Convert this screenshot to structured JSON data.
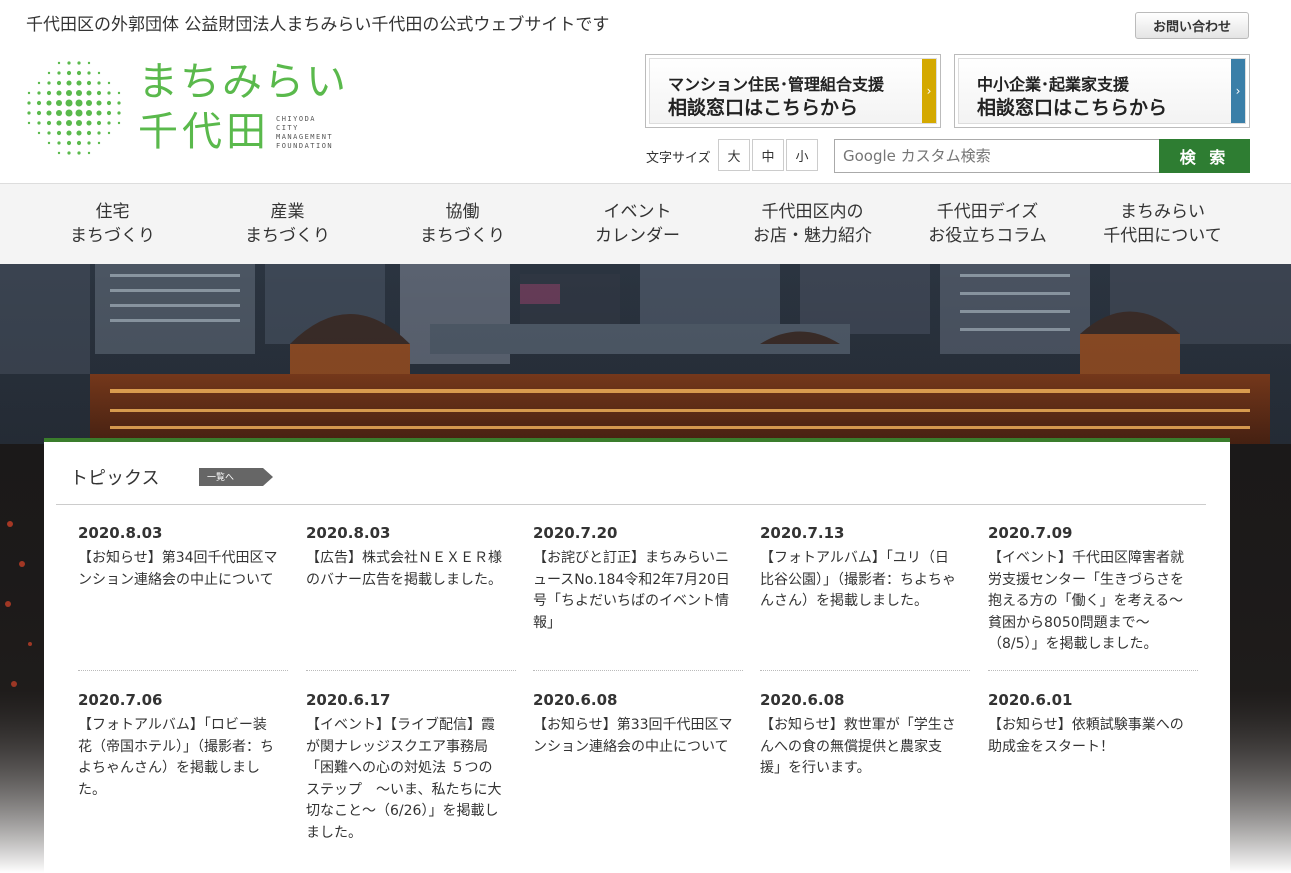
{
  "header": {
    "tagline": "千代田区の外郭団体 公益財団法人まちみらい千代田の公式ウェブサイトです",
    "contact_label": "お問い合わせ",
    "logo": {
      "main": "まちみらい",
      "sub": "千代田",
      "en": [
        "CHIYODA",
        "CITY",
        "MANAGEMENT",
        "FOUNDATION"
      ]
    },
    "banners": [
      {
        "line1": "マンション住民･管理組合支援",
        "line2": "相談窓口はこちらから",
        "arrow": "›",
        "color": "#d4a900"
      },
      {
        "line1": "中小企業･起業家支援",
        "line2": "相談窓口はこちらから",
        "arrow": "›",
        "color": "#3a7fa8"
      }
    ],
    "font_size": {
      "label": "文字サイズ",
      "large": "大",
      "medium": "中",
      "small": "小"
    },
    "search": {
      "placeholder": "Google カスタム検索",
      "button": "検 索"
    }
  },
  "nav": [
    {
      "line1": "住宅",
      "line2": "まちづくり"
    },
    {
      "line1": "産業",
      "line2": "まちづくり"
    },
    {
      "line1": "協働",
      "line2": "まちづくり"
    },
    {
      "line1": "イベント",
      "line2": "カレンダー"
    },
    {
      "line1": "千代田区内の",
      "line2": "お店・魅力紹介"
    },
    {
      "line1": "千代田デイズ",
      "line2": "お役立ちコラム"
    },
    {
      "line1": "まちみらい",
      "line2": "千代田について"
    }
  ],
  "topics": {
    "title": "トピックス",
    "all_label": "一覧へ",
    "items": [
      {
        "date": "2020.8.03",
        "text": "【お知らせ】第34回千代田区マンション連絡会の中止について"
      },
      {
        "date": "2020.8.03",
        "text": "【広告】株式会社ＮＥＸＥＲ様のバナー広告を掲載しました。"
      },
      {
        "date": "2020.7.20",
        "text": "【お詫びと訂正】まちみらいニュースNo.184令和2年7月20日号「ちよだいちばのイベント情報」"
      },
      {
        "date": "2020.7.13",
        "text": "【フォトアルバム】「ユリ（日比谷公園）」（撮影者：ちよちゃんさん）を掲載しました。"
      },
      {
        "date": "2020.7.09",
        "text": "【イベント】千代田区障害者就労支援センター「生きづらさを抱える方の「働く」を考える～貧困から8050問題まで～（8/5）」を掲載しました。"
      },
      {
        "date": "2020.7.06",
        "text": "【フォトアルバム】「ロビー装花（帝国ホテル）」（撮影者：ちよちゃんさん）を掲載しました。"
      },
      {
        "date": "2020.6.17",
        "text": "【イベント】【ライブ配信】霞が関ナレッジスクエア事務局「困難への心の対処法 ５つのステップ　～いま、私たちに大切なこと～（6/26）」を掲載しました。"
      },
      {
        "date": "2020.6.08",
        "text": "【お知らせ】第33回千代田区マンション連絡会の中止について"
      },
      {
        "date": "2020.6.08",
        "text": "【お知らせ】救世軍が「学生さんへの食の無償提供と農家支援」を行います。"
      },
      {
        "date": "2020.6.01",
        "text": "【お知らせ】依頼試験事業への助成金をスタート！"
      }
    ]
  },
  "colors": {
    "brand_green": "#5ab94c",
    "dark_green": "#2e7d32",
    "topic_rule": "#3a7d2c"
  }
}
